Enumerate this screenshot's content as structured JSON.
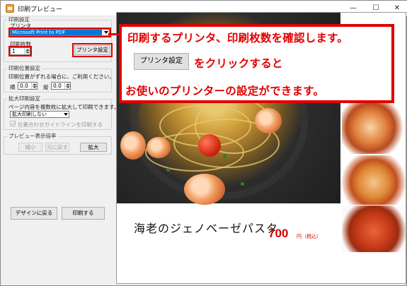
{
  "window": {
    "title": "印刷プレビュー",
    "minimize": "—",
    "maximize": "☐",
    "close": "✕"
  },
  "print_settings": {
    "legend": "印刷設定",
    "printer_label": "プリンタ",
    "printer_value": "Microsoft Print to PDF",
    "copies_label": "印刷枚数",
    "copies_value": "1",
    "printer_settings_button": "プリンタ設定"
  },
  "print_position": {
    "legend": "印刷位置設定",
    "hint": "印刷位置がずれる場合に、ご利用ください。",
    "horizontal_label": "横",
    "horizontal_value": "0.0",
    "vertical_label": "縦",
    "vertical_value": "0.0"
  },
  "enlarge_print": {
    "legend": "拡大印刷設定",
    "hint": "ページ内容を複数枚に拡大して印刷できます。",
    "select_value": "拡大印刷しない",
    "guide_checkbox_label": "位置合わせガイドラインを印刷する"
  },
  "zoom": {
    "legend": "プレビュー表示倍率",
    "shrink_button": "縮小",
    "reset_button": "元に戻す",
    "enlarge_button": "拡大"
  },
  "bottom_buttons": {
    "back_to_design": "デザインに戻る",
    "print": "印刷する"
  },
  "callout": {
    "line1": "印刷するプリンタ、印刷枚数を確認します。",
    "button_label": "プリンタ設定",
    "line2": "をクリックすると",
    "line3": "お使いのプリンターの設定ができます。"
  },
  "preview": {
    "dish_name": "海老のジェノベーゼパスタ",
    "price": "700",
    "price_unit": "円（税込）"
  },
  "colors": {
    "accent_red": "#e00000",
    "selection_blue": "#0078d7",
    "price_red": "#d40000"
  }
}
